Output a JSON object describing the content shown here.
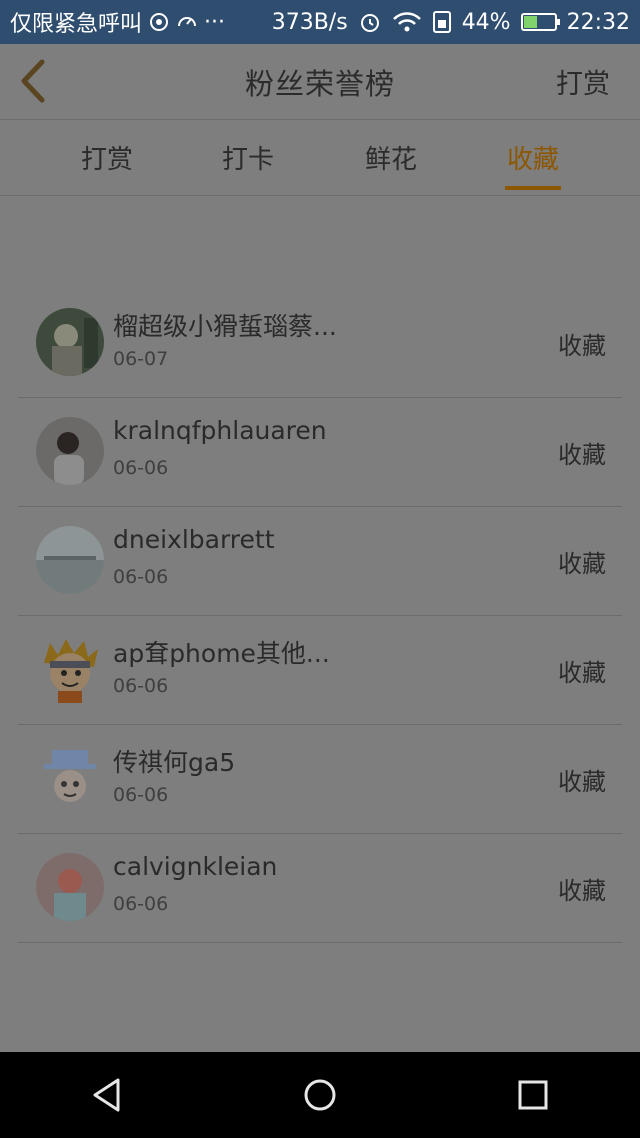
{
  "status_bar": {
    "carrier": "仅限紧急呼叫",
    "dots": "···",
    "speed": "373B/s",
    "battery": "44%",
    "battery_level": 0.44,
    "time": "22:32"
  },
  "header": {
    "title": "粉丝荣誉榜",
    "action": "打赏"
  },
  "tabs": [
    {
      "label": "打赏",
      "active": false
    },
    {
      "label": "打卡",
      "active": false
    },
    {
      "label": "鲜花",
      "active": false
    },
    {
      "label": "收藏",
      "active": true
    }
  ],
  "fans": [
    {
      "name": "榴超级小猾蜇瑙蔡...",
      "date": "06-07",
      "action": "收藏",
      "avatar": "photo-icon"
    },
    {
      "name": "kralnqfphlauaren",
      "date": "06-06",
      "action": "收藏",
      "avatar": "photo-icon"
    },
    {
      "name": "dneixlbarrett",
      "date": "06-06",
      "action": "收藏",
      "avatar": "photo-icon"
    },
    {
      "name": "ap耷phome其他...",
      "date": "06-06",
      "action": "收藏",
      "avatar": "cartoon-icon"
    },
    {
      "name": "传祺何ga5",
      "date": "06-06",
      "action": "收藏",
      "avatar": "cartoon-icon"
    },
    {
      "name": "calvignkleian",
      "date": "06-06",
      "action": "收藏",
      "avatar": "photo-icon"
    }
  ],
  "colors": {
    "accent": "#8c5700",
    "status_bar": "#2f4e6f",
    "overlay_bg": "#7e7e7e"
  }
}
